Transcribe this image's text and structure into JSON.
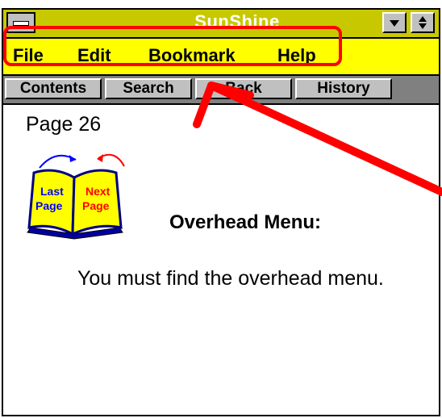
{
  "window": {
    "title": "SunShine"
  },
  "menu": {
    "items": [
      {
        "label": "File"
      },
      {
        "label": "Edit"
      },
      {
        "label": "Bookmark"
      },
      {
        "label": "Help"
      }
    ]
  },
  "buttons": {
    "items": [
      {
        "label": "Contents"
      },
      {
        "label": "Search"
      },
      {
        "label": "Back"
      },
      {
        "label": "History"
      }
    ]
  },
  "content": {
    "page_label": "Page 26",
    "book": {
      "left_page_line1": "Last",
      "left_page_line2": "Page",
      "right_page_line1": "Next",
      "right_page_line2": "Page"
    },
    "heading": "Overhead Menu:",
    "body": "You must find the overhead menu."
  },
  "colors": {
    "window_bg": "#ffff00",
    "titlebar_bg": "#c8c800",
    "highlight": "#ff0000",
    "button_face": "#c0c0c0"
  },
  "icons": [
    "system-menu-icon",
    "minimize-icon",
    "maximize-icon",
    "book-icon",
    "red-arrow-icon"
  ]
}
